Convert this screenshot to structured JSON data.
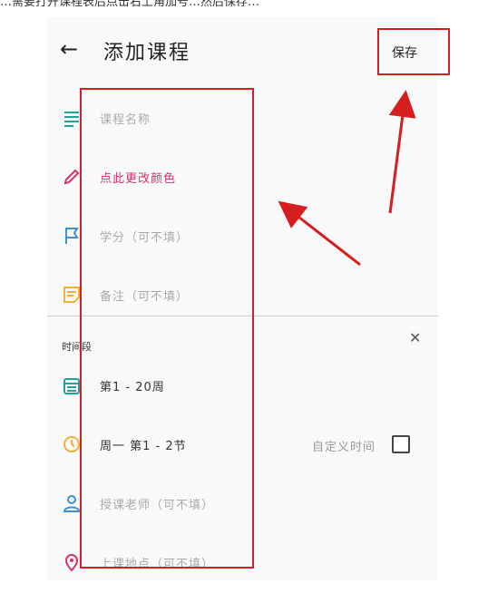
{
  "caption": "…需要打开课程表后点击右上角加号…然后保存…",
  "header": {
    "back_icon": "arrow-left-icon",
    "title": "添加课程",
    "save_label": "保存"
  },
  "fields": {
    "course_name_placeholder": "课程名称",
    "color_label": "点此更改颜色",
    "credit_placeholder": "学分（可不填）",
    "note_placeholder": "备注（可不填）"
  },
  "timeslot": {
    "section_label": "时间段",
    "close_icon": "close-icon",
    "weeks": "第1 - 20周",
    "day_periods": "周一   第1 - 2节",
    "custom_time_label": "自定义时间",
    "teacher_placeholder": "授课老师（可不填）",
    "location_placeholder": "上课地点（可不填）"
  },
  "icons": {
    "course_name": "list-lines-icon",
    "color": "pen-icon",
    "credit": "flag-icon",
    "note": "note-icon",
    "weeks": "calendar-icon",
    "time": "clock-icon",
    "teacher": "person-icon",
    "location": "location-pin-icon"
  },
  "colors": {
    "accent_red": "#d6336c",
    "annotation_red": "#d61e1e",
    "teal": "#1fa39a",
    "blue": "#3d8fd8",
    "yellow": "#f2b134"
  }
}
